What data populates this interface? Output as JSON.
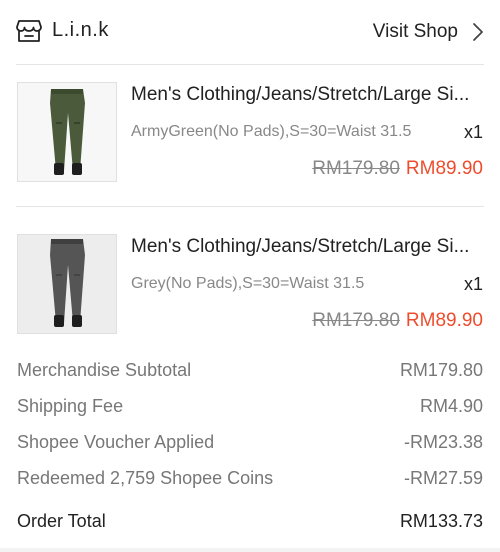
{
  "shop": {
    "name": "L.i.n.k",
    "visit_label": "Visit Shop",
    "icon": "shop-icon"
  },
  "items": [
    {
      "title": "Men's Clothing/Jeans/Stretch/Large Si...",
      "variant": "ArmyGreen(No Pads),S=30=Waist 31.5",
      "qty": "x1",
      "original_price": "RM179.80",
      "price": "RM89.90",
      "image_color": "#4a5a3a"
    },
    {
      "title": "Men's Clothing/Jeans/Stretch/Large Si...",
      "variant": "Grey(No Pads),S=30=Waist 31.5",
      "qty": "x1",
      "original_price": "RM179.80",
      "price": "RM89.90",
      "image_color": "#5a5a5a"
    }
  ],
  "summary": {
    "subtotal_label": "Merchandise Subtotal",
    "subtotal_value": "RM179.80",
    "shipping_label": "Shipping Fee",
    "shipping_value": "RM4.90",
    "voucher_label": "Shopee Voucher Applied",
    "voucher_value": "-RM23.38",
    "coins_label": "Redeemed 2,759 Shopee Coins",
    "coins_value": "-RM27.59",
    "total_label": "Order Total",
    "total_value": "RM133.73"
  },
  "colors": {
    "accent": "#ee4d2d",
    "muted": "#888888"
  }
}
